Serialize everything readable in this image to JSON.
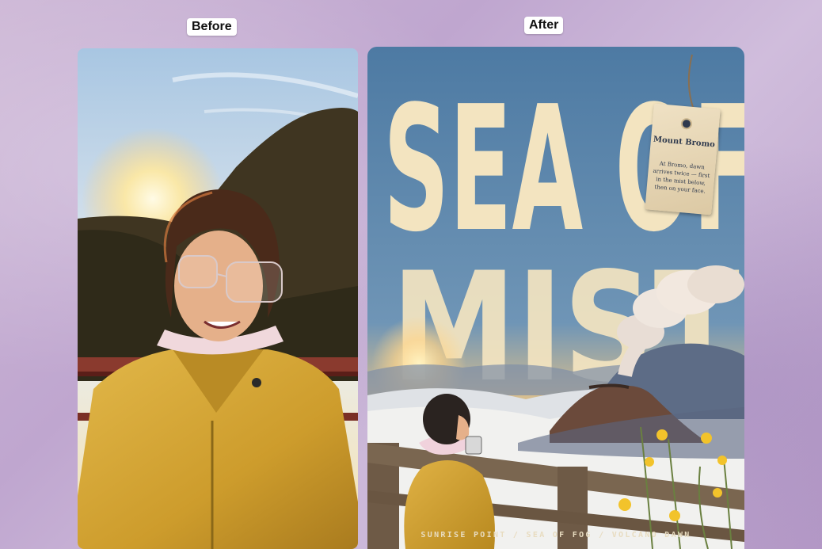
{
  "labels": {
    "before": "Before",
    "after": "After"
  },
  "poster": {
    "title_line1": "SEA OF",
    "title_line2": "MIST",
    "tag_title": "Mount Bromo",
    "tag_body": "At Bromo, dawn arrives twice — first in the mist below, then on your face.",
    "footer": "SUNRISE POINT / SEA OF FOG / VOLCANO DAWN"
  },
  "colors": {
    "poster_text": "#f3e4c0",
    "jacket": "#d2a431",
    "sky_blue": "#4f7fa6",
    "volcano": "#6b4a3b",
    "background": "#c7b1d3"
  }
}
